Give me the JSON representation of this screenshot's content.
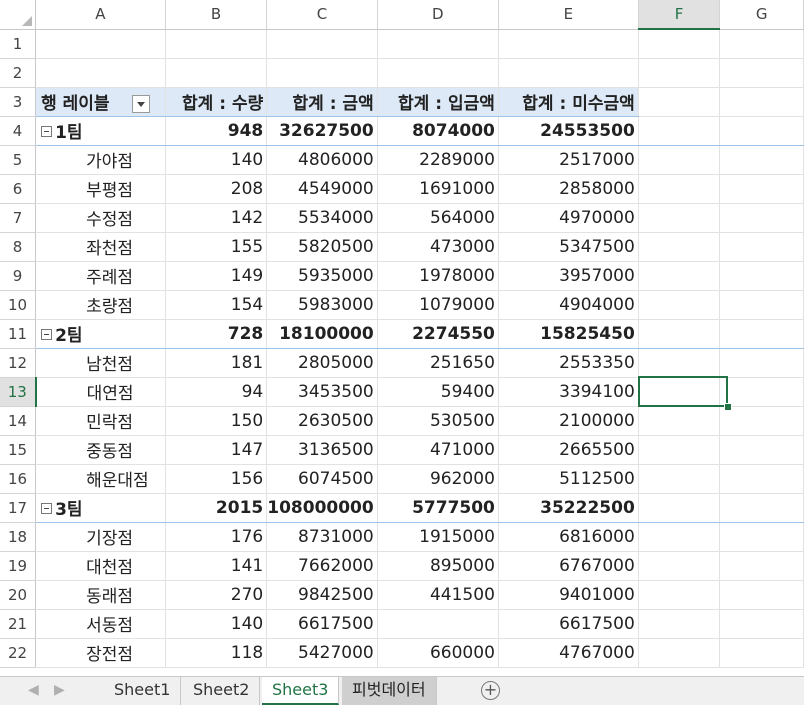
{
  "columns": [
    "A",
    "B",
    "C",
    "D",
    "E",
    "F",
    "G"
  ],
  "selected_column": "F",
  "selected_row": "13",
  "row_numbers": [
    "1",
    "2",
    "3",
    "4",
    "5",
    "6",
    "7",
    "8",
    "9",
    "10",
    "11",
    "12",
    "13",
    "14",
    "15",
    "16",
    "17",
    "18",
    "19",
    "20",
    "21",
    "22"
  ],
  "pivot": {
    "headers": {
      "row_label": "행 레이블",
      "qty": "합계 : 수량",
      "amount": "합계 : 금액",
      "paid": "합계 : 입금액",
      "unpaid": "합계 : 미수금액"
    },
    "teams": [
      {
        "name": "1팀",
        "qty": "948",
        "amount": "32627500",
        "paid": "8074000",
        "unpaid": "24553500",
        "stores": [
          {
            "name": "가야점",
            "qty": "140",
            "amount": "4806000",
            "paid": "2289000",
            "unpaid": "2517000"
          },
          {
            "name": "부평점",
            "qty": "208",
            "amount": "4549000",
            "paid": "1691000",
            "unpaid": "2858000"
          },
          {
            "name": "수정점",
            "qty": "142",
            "amount": "5534000",
            "paid": "564000",
            "unpaid": "4970000"
          },
          {
            "name": "좌천점",
            "qty": "155",
            "amount": "5820500",
            "paid": "473000",
            "unpaid": "5347500"
          },
          {
            "name": "주례점",
            "qty": "149",
            "amount": "5935000",
            "paid": "1978000",
            "unpaid": "3957000"
          },
          {
            "name": "초량점",
            "qty": "154",
            "amount": "5983000",
            "paid": "1079000",
            "unpaid": "4904000"
          }
        ]
      },
      {
        "name": "2팀",
        "qty": "728",
        "amount": "18100000",
        "paid": "2274550",
        "unpaid": "15825450",
        "stores": [
          {
            "name": "남천점",
            "qty": "181",
            "amount": "2805000",
            "paid": "251650",
            "unpaid": "2553350"
          },
          {
            "name": "대연점",
            "qty": "94",
            "amount": "3453500",
            "paid": "59400",
            "unpaid": "3394100"
          },
          {
            "name": "민락점",
            "qty": "150",
            "amount": "2630500",
            "paid": "530500",
            "unpaid": "2100000"
          },
          {
            "name": "중동점",
            "qty": "147",
            "amount": "3136500",
            "paid": "471000",
            "unpaid": "2665500"
          },
          {
            "name": "해운대점",
            "qty": "156",
            "amount": "6074500",
            "paid": "962000",
            "unpaid": "5112500"
          }
        ]
      },
      {
        "name": "3팀",
        "qty": "2015",
        "amount": "108000000",
        "paid": "5777500",
        "unpaid": "35222500",
        "stores": [
          {
            "name": "기장점",
            "qty": "176",
            "amount": "8731000",
            "paid": "1915000",
            "unpaid": "6816000"
          },
          {
            "name": "대천점",
            "qty": "141",
            "amount": "7662000",
            "paid": "895000",
            "unpaid": "6767000"
          },
          {
            "name": "동래점",
            "qty": "270",
            "amount": "9842500",
            "paid": "441500",
            "unpaid": "9401000"
          },
          {
            "name": "서동점",
            "qty": "140",
            "amount": "6617500",
            "paid": "",
            "unpaid": "6617500"
          },
          {
            "name": "장전점",
            "qty": "118",
            "amount": "5427000",
            "paid": "660000",
            "unpaid": "4767000"
          }
        ]
      }
    ]
  },
  "sheet_tabs": [
    {
      "label": "Sheet1",
      "state": "normal"
    },
    {
      "label": "Sheet2",
      "state": "normal"
    },
    {
      "label": "Sheet3",
      "state": "active"
    },
    {
      "label": "피벗데이터",
      "state": "dark"
    }
  ],
  "add_sheet_label": "+"
}
